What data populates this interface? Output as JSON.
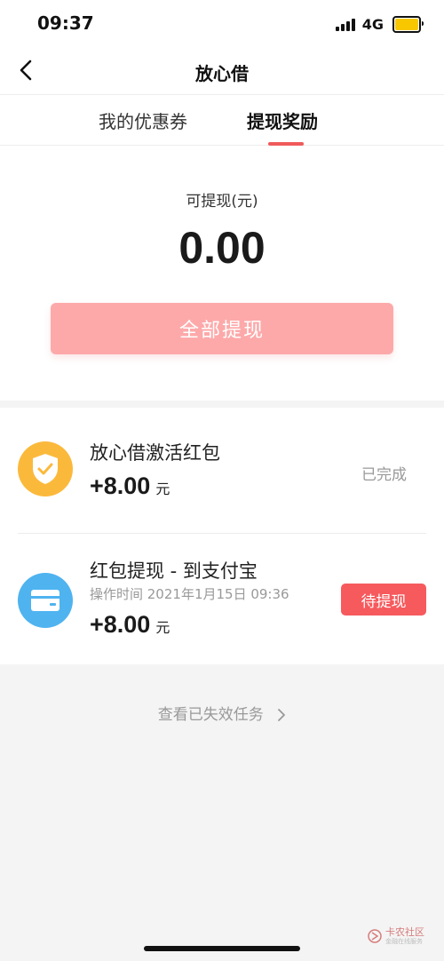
{
  "status_bar": {
    "time": "09:37",
    "network": "4G"
  },
  "nav": {
    "title": "放心借"
  },
  "tabs": [
    {
      "label": "我的优惠券",
      "active": false
    },
    {
      "label": "提现奖励",
      "active": true
    }
  ],
  "balance": {
    "label": "可提现(元)",
    "amount": "0.00",
    "withdraw_all_label": "全部提现"
  },
  "tasks": [
    {
      "title": "放心借激活红包",
      "amount": "+8.00",
      "unit": "元",
      "status": "已完成",
      "icon": "shield-check-icon",
      "icon_color": "#fbb93c"
    },
    {
      "title": "红包提现 - 到支付宝",
      "time": "操作时间 2021年1月15日 09:36",
      "amount": "+8.00",
      "unit": "元",
      "action_label": "待提现",
      "icon": "card-icon",
      "icon_color": "#4fb3f0"
    }
  ],
  "expired_link": "查看已失效任务",
  "watermark": {
    "text": "卡农社区",
    "sub": "金融在线服务"
  },
  "colors": {
    "accent": "#f05a5a",
    "button_disabled": "#fda9aa",
    "pending": "#f65a5d"
  }
}
